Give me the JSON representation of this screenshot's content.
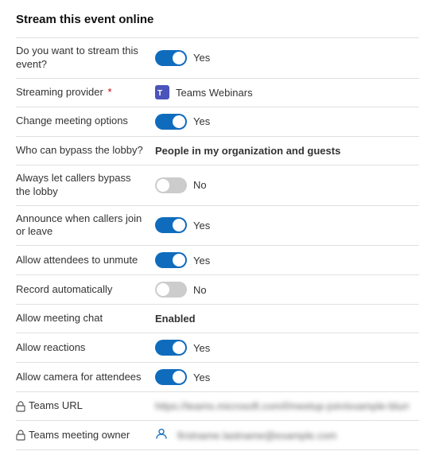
{
  "title": "Stream this event online",
  "rows": [
    {
      "id": "stream-event",
      "label": "Do you want to stream this event?",
      "type": "toggle",
      "state": "on",
      "value_label": "Yes",
      "required": false,
      "has_lock": false
    },
    {
      "id": "streaming-provider",
      "label": "Streaming provider",
      "type": "provider",
      "provider_name": "Teams Webinars",
      "required": true,
      "has_lock": false
    },
    {
      "id": "change-meeting-options",
      "label": "Change meeting options",
      "type": "toggle",
      "state": "on",
      "value_label": "Yes",
      "required": false,
      "has_lock": false
    },
    {
      "id": "bypass-lobby",
      "label": "Who can bypass the lobby?",
      "type": "text",
      "value_label": "People in my organization and guests",
      "bold": true,
      "required": false,
      "has_lock": false
    },
    {
      "id": "callers-bypass",
      "label": "Always let callers bypass the lobby",
      "type": "toggle",
      "state": "off",
      "value_label": "No",
      "required": false,
      "has_lock": false
    },
    {
      "id": "announce-callers",
      "label": "Announce when callers join or leave",
      "type": "toggle",
      "state": "on",
      "value_label": "Yes",
      "required": false,
      "has_lock": false
    },
    {
      "id": "allow-unmute",
      "label": "Allow attendees to unmute",
      "type": "toggle",
      "state": "on",
      "value_label": "Yes",
      "required": false,
      "has_lock": false
    },
    {
      "id": "record-automatically",
      "label": "Record automatically",
      "type": "toggle",
      "state": "off",
      "value_label": "No",
      "required": false,
      "has_lock": false
    },
    {
      "id": "allow-meeting-chat",
      "label": "Allow meeting chat",
      "type": "text",
      "value_label": "Enabled",
      "bold": true,
      "required": false,
      "has_lock": false
    },
    {
      "id": "allow-reactions",
      "label": "Allow reactions",
      "type": "toggle",
      "state": "on",
      "value_label": "Yes",
      "required": false,
      "has_lock": false
    },
    {
      "id": "allow-camera",
      "label": "Allow camera for attendees",
      "type": "toggle",
      "state": "on",
      "value_label": "Yes",
      "required": false,
      "has_lock": false
    },
    {
      "id": "teams-url",
      "label": "Teams URL",
      "type": "url",
      "value_label": "https://teams.microsoft.com/l/meetup-join/example-blurred-url-data",
      "required": false,
      "has_lock": true
    },
    {
      "id": "teams-owner",
      "label": "Teams meeting owner",
      "type": "owner",
      "value_label": "firstname.lastname@example.com",
      "required": false,
      "has_lock": true
    }
  ]
}
